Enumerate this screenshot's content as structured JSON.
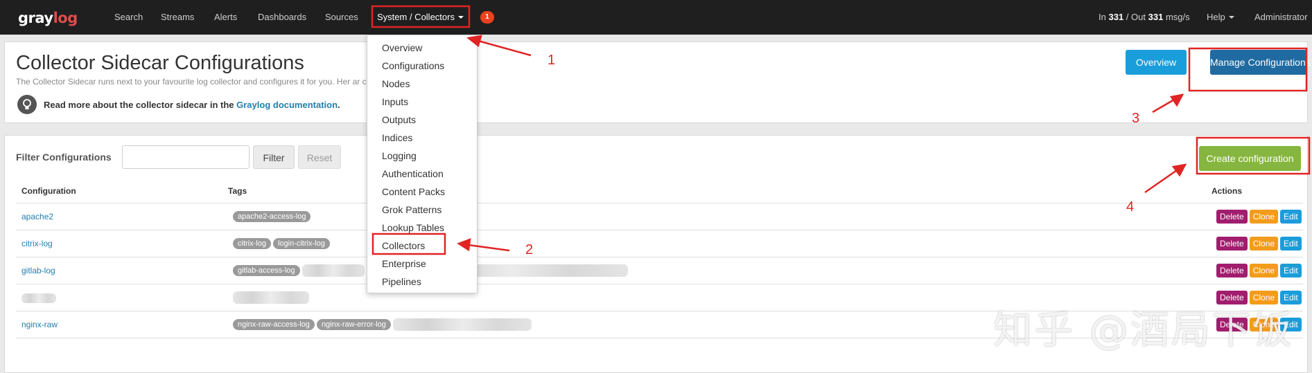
{
  "nav": {
    "logo_main": "gray",
    "logo_accent": "log",
    "items": [
      "Search",
      "Streams",
      "Alerts",
      "Dashboards",
      "Sources"
    ],
    "active": "System / Collectors",
    "badge": "1",
    "throughput_in_label": "In",
    "throughput_in": "331",
    "throughput_out_label": "/ Out",
    "throughput_out": "331",
    "throughput_unit": "msg/s",
    "help": "Help",
    "user": "Administrator"
  },
  "header": {
    "title": "Collector Sidecar Configurations",
    "description": "The Collector Sidecar runs next to your favourite log collector and configures it for you. Her                                                  ar configurations.",
    "info_prefix": "Read more about the collector sidecar in the",
    "info_link": "Graylog documentation",
    "info_suffix": ".",
    "btn_overview": "Overview",
    "btn_manage": "Manage Configurations"
  },
  "filter": {
    "label": "Filter Configurations",
    "input_value": "",
    "btn_filter": "Filter",
    "btn_reset": "Reset",
    "btn_create": "Create configuration"
  },
  "table": {
    "col_config": "Configuration",
    "col_tags": "Tags",
    "col_actions": "Actions",
    "action_delete": "Delete",
    "action_clone": "Clone",
    "action_edit": "Edit",
    "rows": [
      {
        "name": "apache2",
        "tags": [
          "apache2-access-log"
        ]
      },
      {
        "name": "citrix-log",
        "tags": [
          "citrix-log",
          "login-citrix-log"
        ]
      },
      {
        "name": "gitlab-log",
        "tags": [
          "gitlab-access-log"
        ]
      },
      {
        "name": "",
        "tags": []
      },
      {
        "name": "nginx-raw",
        "tags": [
          "nginx-raw-access-log",
          "nginx-raw-error-log"
        ]
      }
    ]
  },
  "dropdown": {
    "items": [
      "Overview",
      "Configurations",
      "Nodes",
      "Inputs",
      "Outputs",
      "Indices",
      "Logging",
      "Authentication",
      "Content Packs",
      "Grok Patterns",
      "Lookup Tables",
      "Collectors",
      "Enterprise",
      "Pipelines"
    ]
  },
  "annotations": {
    "n1": "1",
    "n2": "2",
    "n3": "3",
    "n4": "4",
    "color": "#e02424"
  },
  "watermark": "知乎 @酒局下饭"
}
